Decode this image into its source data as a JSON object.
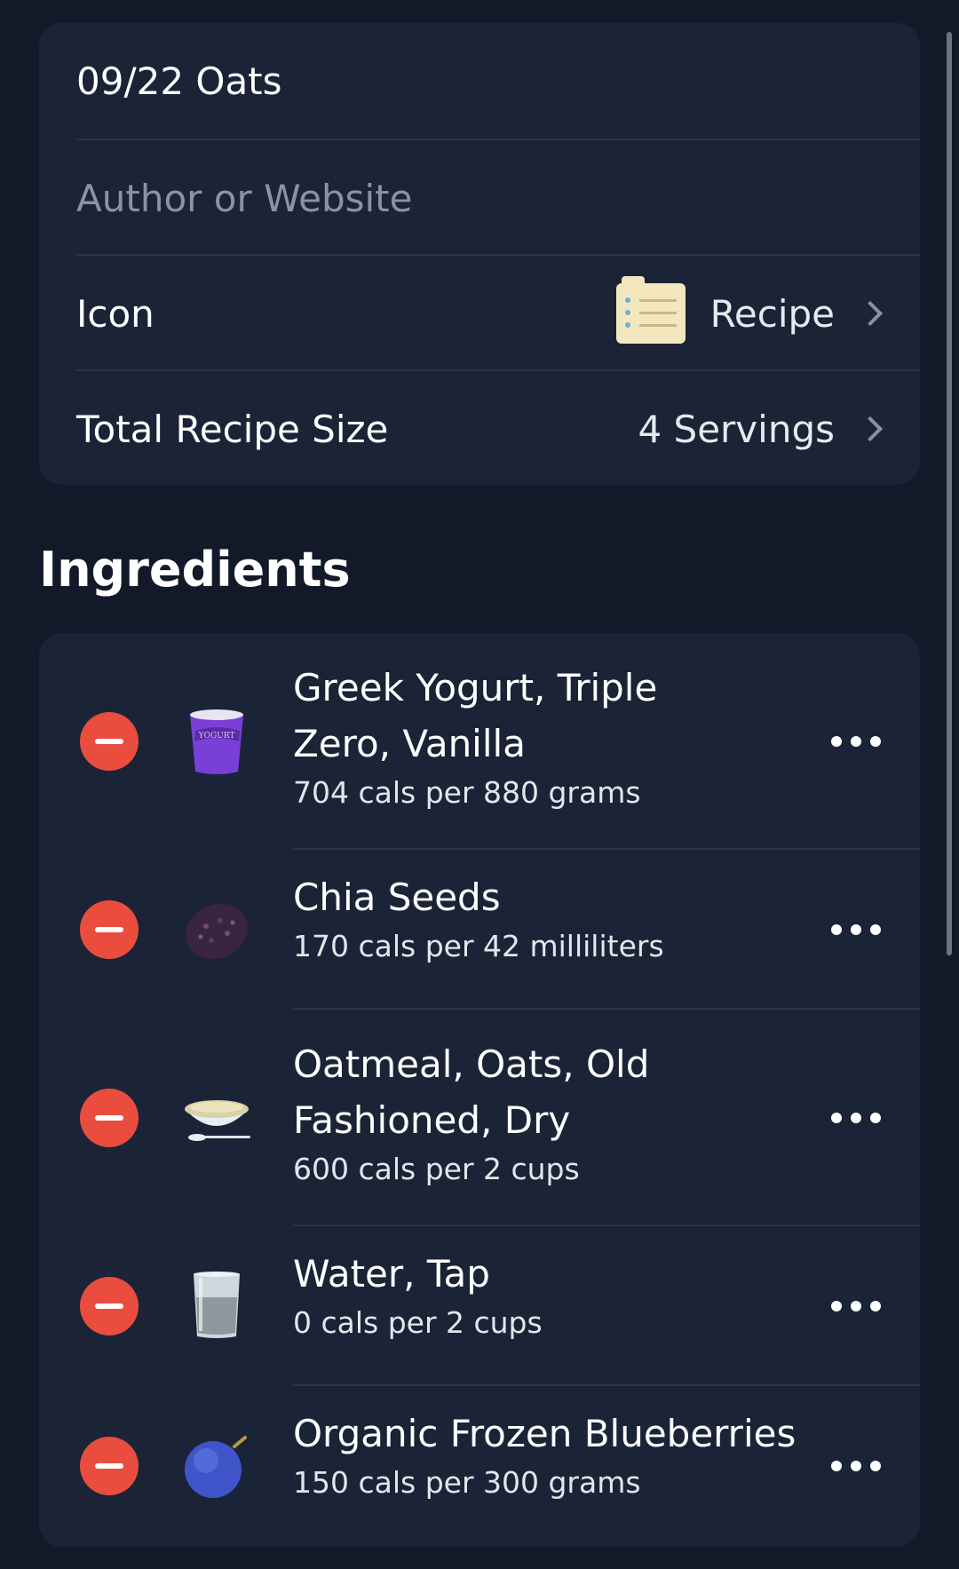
{
  "recipe": {
    "title": "09/22 Oats",
    "author_placeholder": "Author or Website",
    "icon_label": "Icon",
    "icon_value": "Recipe",
    "icon_name": "recipe-notepad-icon",
    "size_label": "Total Recipe Size",
    "size_value": "4 Servings"
  },
  "ingredients_section": {
    "title": "Ingredients",
    "items": [
      {
        "name_line1": "Greek Yogurt, Triple",
        "name_line2": "Zero, Vanilla",
        "detail": "704 cals per 880 grams",
        "icon": "yogurt-cup-icon"
      },
      {
        "name_line1": "Chia Seeds",
        "name_line2": "",
        "detail": "170 cals per 42 milliliters",
        "icon": "chia-seeds-icon"
      },
      {
        "name_line1": "Oatmeal, Oats, Old",
        "name_line2": "Fashioned, Dry",
        "detail": "600 cals per 2 cups",
        "icon": "oatmeal-bowl-icon"
      },
      {
        "name_line1": "Water, Tap",
        "name_line2": "",
        "detail": "0 cals per 2 cups",
        "icon": "water-glass-icon"
      },
      {
        "name_line1": "Organic Frozen Blueberries",
        "name_line2": "",
        "detail": "150 cals per 300 grams",
        "icon": "blueberry-icon"
      }
    ]
  },
  "colors": {
    "background": "#121a29",
    "card": "#1a2436",
    "remove": "#ea4d3d",
    "divider": "#2b3549"
  }
}
